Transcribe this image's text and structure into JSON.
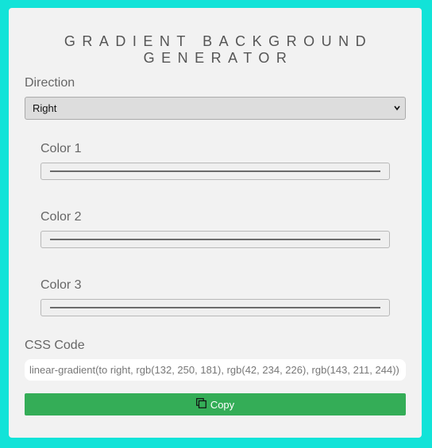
{
  "title": "GRADIENT BACKGROUND GENERATOR",
  "direction": {
    "label": "Direction",
    "selected": "Right"
  },
  "colors": [
    {
      "label": "Color 1"
    },
    {
      "label": "Color 2"
    },
    {
      "label": "Color 3"
    }
  ],
  "css_code": {
    "label": "CSS Code",
    "value": "linear-gradient(to right, rgb(132, 250, 181), rgb(42, 234, 226), rgb(143, 211, 244))"
  },
  "copy": {
    "label": "Copy",
    "icon": "copy-icon"
  },
  "theme": {
    "page_background": "#12e3d8",
    "card_background": "#f2f2f2",
    "button_color": "#34ad57"
  }
}
